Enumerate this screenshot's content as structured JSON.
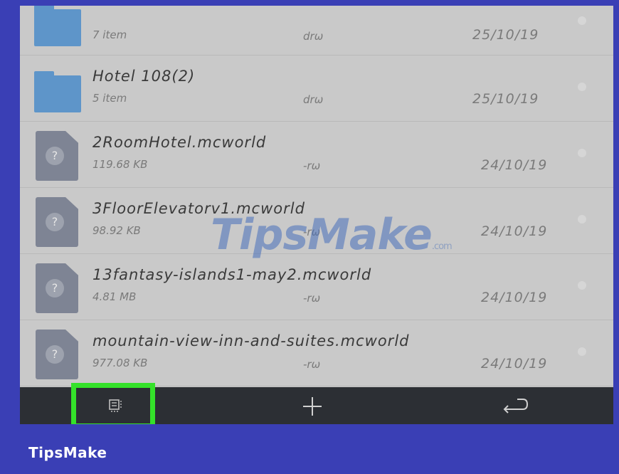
{
  "files": [
    {
      "name": "",
      "meta": "7 item",
      "perm": "drω",
      "date": "25/10/19",
      "type": "folder"
    },
    {
      "name": "Hotel 108(2)",
      "meta": "5 item",
      "perm": "drω",
      "date": "25/10/19",
      "type": "folder"
    },
    {
      "name": "2RoomHotel.mcworld",
      "meta": "119.68 KB",
      "perm": "-rω",
      "date": "24/10/19",
      "type": "file"
    },
    {
      "name": "3FloorElevatorv1.mcworld",
      "meta": "98.92 KB",
      "perm": "-rω",
      "date": "24/10/19",
      "type": "file"
    },
    {
      "name": "13fantasy-islands1-may2.mcworld",
      "meta": "4.81 MB",
      "perm": "-rω",
      "date": "24/10/19",
      "type": "file"
    },
    {
      "name": "mountain-view-inn-and-suites.mcworld",
      "meta": "977.08 KB",
      "perm": "-rω",
      "date": "24/10/19",
      "type": "file"
    }
  ],
  "icons": {
    "unknown_file": "?",
    "bottom_bar": [
      "select-icon",
      "plus-icon",
      "back-icon"
    ]
  },
  "watermark": {
    "text": "TipsMake",
    "suffix": ".com"
  },
  "brand": "TipsMake",
  "colors": {
    "frame": "#3a3fb5",
    "highlight": "#34e22a",
    "folder": "#5e95c9",
    "bottom_bar": "#2c2f34"
  }
}
